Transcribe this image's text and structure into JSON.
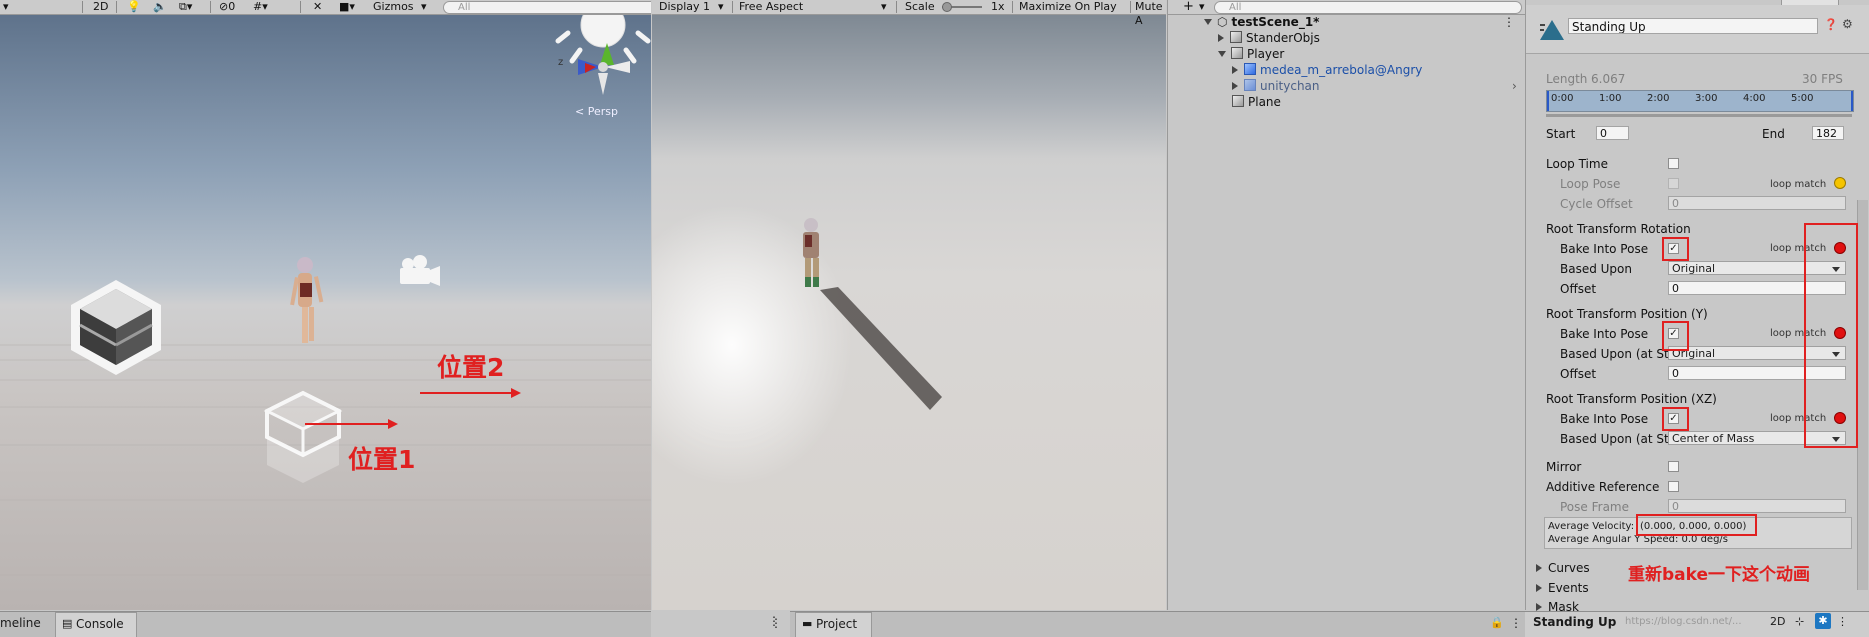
{
  "scene_toolbar": {
    "mode_2d": "2D",
    "hidden_count": "0",
    "gizmos": "Gizmos",
    "search_placeholder": "All",
    "persp_label": "< Persp",
    "axis_z": "z"
  },
  "game_toolbar": {
    "display": "Display 1",
    "aspect": "Free Aspect",
    "scale_label": "Scale",
    "scale_value": "1x",
    "maximize": "Maximize On Play",
    "mute": "Mute A"
  },
  "hierarchy": {
    "search_placeholder": "All",
    "add_label": "+",
    "items": [
      {
        "label": "testScene_1*"
      },
      {
        "label": "StanderObjs"
      },
      {
        "label": "Player"
      },
      {
        "label": "medea_m_arrebola@Angry"
      },
      {
        "label": "unitychan"
      },
      {
        "label": "Plane"
      }
    ]
  },
  "inspector": {
    "clip_name": "Standing Up",
    "length_label": "Length",
    "length_value": "6.067",
    "fps": "30 FPS",
    "timeline_ticks": [
      "0:00",
      "1:00",
      "2:00",
      "3:00",
      "4:00",
      "5:00"
    ],
    "start_label": "Start",
    "start_value": "0",
    "end_label": "End",
    "end_value": "182",
    "loop_time": "Loop Time",
    "loop_pose": "Loop Pose",
    "loop_match": "loop match",
    "cycle_offset": "Cycle Offset",
    "cycle_offset_value": "0",
    "rot_header": "Root Transform Rotation",
    "bake_into_pose": "Bake Into Pose",
    "based_upon": "Based Upon",
    "based_upon_value": "Original",
    "offset": "Offset",
    "offset_value": "0",
    "posy_header": "Root Transform Position (Y)",
    "based_upon_at": "Based Upon (at Sta",
    "posy_based_value": "Original",
    "posy_offset_value": "0",
    "posxz_header": "Root Transform Position (XZ)",
    "posxz_based_value": "Center of Mass",
    "mirror": "Mirror",
    "additive": "Additive Reference P",
    "pose_frame": "Pose Frame",
    "pose_frame_value": "0",
    "avg_velocity_label": "Average Velocity:",
    "avg_velocity_value": "(0.000, 0.000, 0.000)",
    "avg_angular": "Average Angular Y Speed: 0.0 deg/s",
    "curves": "Curves",
    "events": "Events",
    "mask": "Mask",
    "check_mark": "✓"
  },
  "annotations": {
    "pos1": "位置1",
    "pos2": "位置2",
    "rebake": "重新bake一下这个动画"
  },
  "bottom": {
    "timeline_tab": "meline",
    "console_tab": "Console",
    "project_tab": "Project",
    "preview_title": "Standing Up",
    "preview_2d": "2D",
    "watermark": "https://blog.csdn.net/..."
  },
  "colors": {
    "annotation_red": "#e02020",
    "loop_red": "#e01010",
    "loop_yellow": "#f5c400"
  }
}
